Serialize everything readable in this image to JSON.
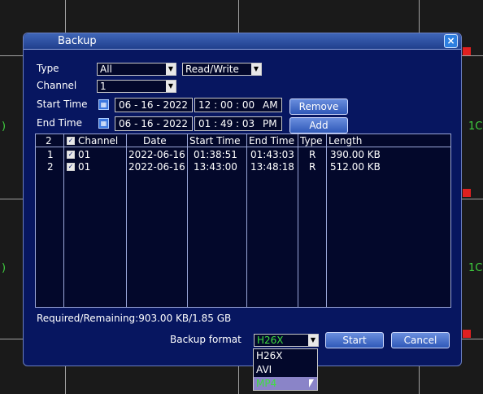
{
  "dialog": {
    "title": "Backup",
    "close_label": "×"
  },
  "filters": {
    "type_label": "Type",
    "type_value": "All",
    "rw_value": "Read/Write",
    "channel_label": "Channel",
    "channel_value": "1",
    "start_label": "Start Time",
    "start_date": "06 - 16 - 2022",
    "start_time": "12 : 00 : 00",
    "start_ampm": "AM",
    "end_label": "End Time",
    "end_date": "06 - 16 - 2022",
    "end_time": "01 : 49 : 03",
    "end_ampm": "PM",
    "remove_label": "Remove",
    "add_label": "Add"
  },
  "table": {
    "count": "2",
    "headers": [
      "Channel",
      "Date",
      "Start Time",
      "End Time",
      "Type",
      "Length"
    ],
    "rows": [
      {
        "num": "1",
        "channel": "01",
        "date": "2022-06-16",
        "start": "01:38:51",
        "end": "01:43:03",
        "type": "R",
        "length": "390.00 KB"
      },
      {
        "num": "2",
        "channel": "01",
        "date": "2022-06-16",
        "start": "13:43:00",
        "end": "13:48:18",
        "type": "R",
        "length": "512.00 KB"
      }
    ]
  },
  "footer": {
    "required_text": "Required/Remaining:903.00 KB/1.85 GB",
    "format_label": "Backup format",
    "format_value": "H26X",
    "start_label": "Start",
    "cancel_label": "Cancel",
    "options": [
      "H26X",
      "AVI",
      "MP4"
    ]
  },
  "background": {
    "edge_left": ")",
    "edge_right": "1C"
  },
  "colors": {
    "dialog_bg": "#071660",
    "title_bar": "#3f66b8",
    "selected_option": "#8a84c8"
  }
}
